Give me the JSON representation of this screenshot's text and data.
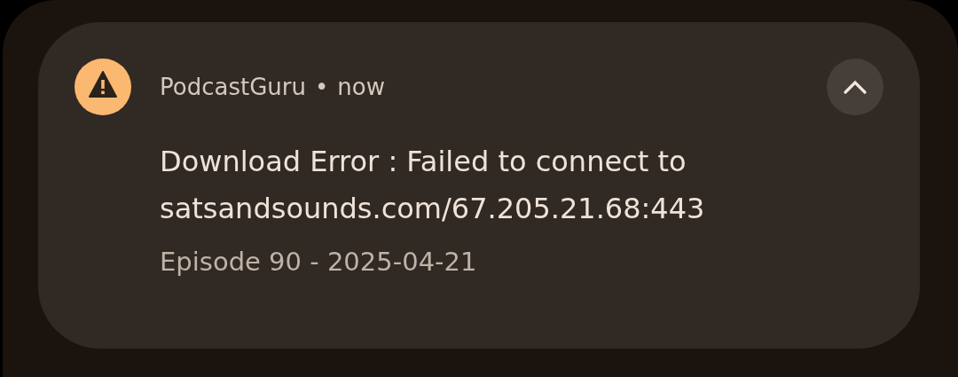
{
  "notification": {
    "app_name": "PodcastGuru",
    "separator": "•",
    "time": "now",
    "expanded": true,
    "title": "Download Error : Failed to connect to satsandsounds.com/67.205.21.68:443",
    "text": "Episode 90 - 2025-04-21"
  }
}
